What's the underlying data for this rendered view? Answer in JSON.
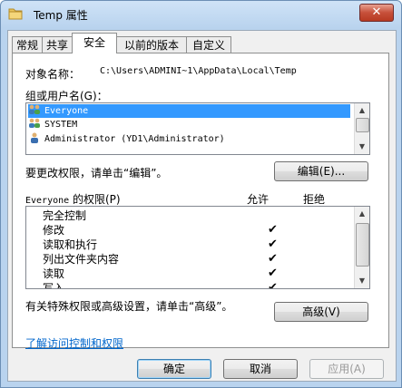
{
  "window": {
    "title": "Temp 属性",
    "close_label": "✕"
  },
  "tabs": [
    "常规",
    "共享",
    "安全",
    "以前的版本",
    "自定义"
  ],
  "active_tab": "安全",
  "object": {
    "label": "对象名称：",
    "path": "C:\\Users\\ADMINI~1\\AppData\\Local\\Temp"
  },
  "groups": {
    "label": "组或用户名(G)：",
    "items": [
      "Everyone",
      "SYSTEM",
      "Administrator (YD1\\Administrator)"
    ],
    "selected": "Everyone"
  },
  "edit": {
    "hint": "要更改权限，请单击“编辑”。",
    "button": "编辑(E)..."
  },
  "permissions": {
    "header_user": "Everyone",
    "header_suffix": " 的权限(P)",
    "allow_label": "允许",
    "deny_label": "拒绝",
    "rows": [
      {
        "name": "完全控制",
        "allow": ""
      },
      {
        "name": "修改",
        "allow": "✔"
      },
      {
        "name": "读取和执行",
        "allow": "✔"
      },
      {
        "name": "列出文件夹内容",
        "allow": "✔"
      },
      {
        "name": "读取",
        "allow": "✔"
      },
      {
        "name": "写入",
        "allow": "✔"
      }
    ]
  },
  "advanced": {
    "hint": "有关特殊权限或高级设置，请单击“高级”。",
    "button": "高级(V)"
  },
  "link": "了解访问控制和权限",
  "footer": {
    "ok": "确定",
    "cancel": "取消",
    "apply": "应用(A)"
  },
  "colors": {
    "selection": "#3399ff",
    "link": "#0066cc",
    "title_bar": "#b9d3ee"
  }
}
